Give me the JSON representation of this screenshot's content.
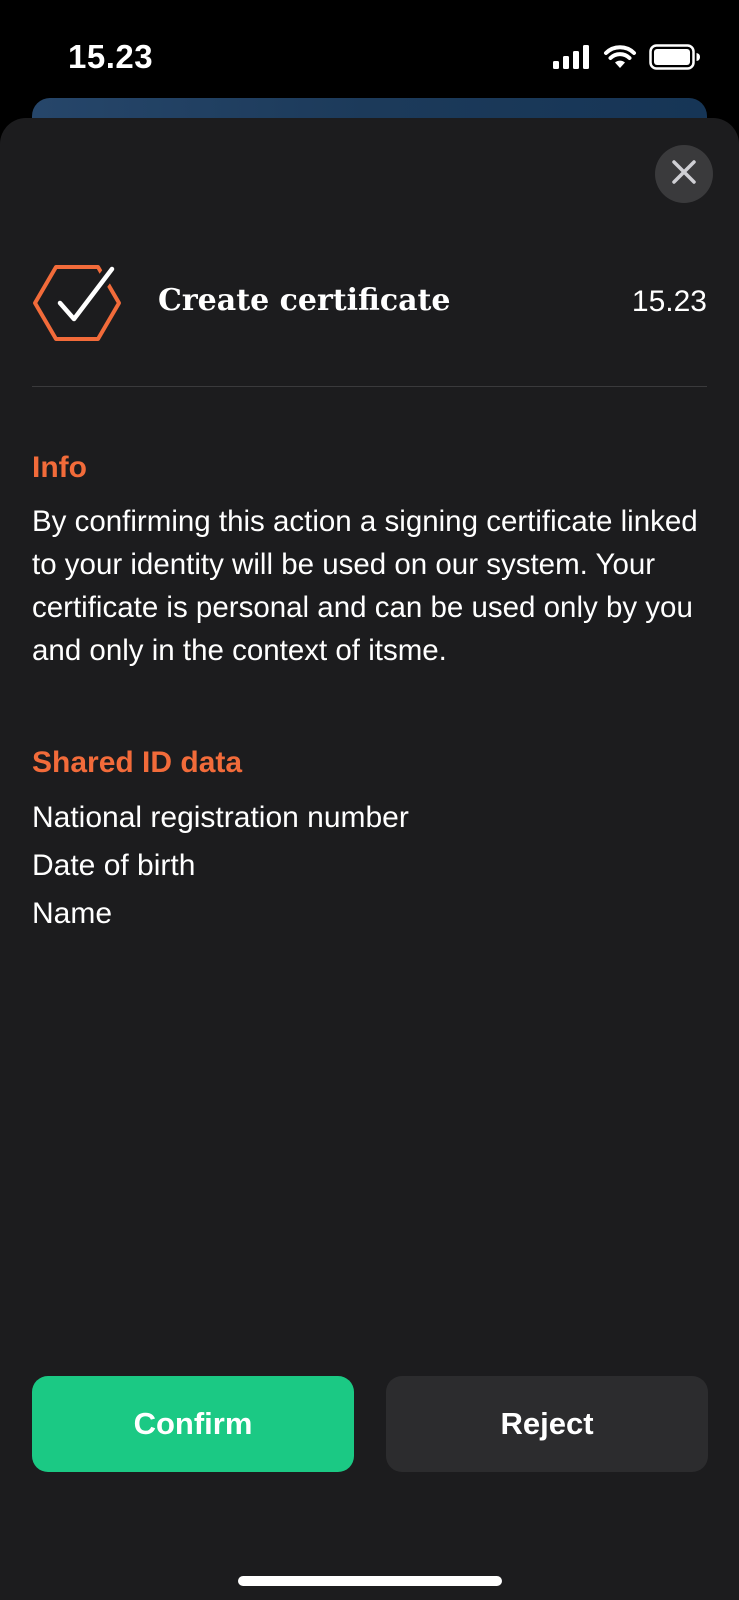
{
  "status_bar": {
    "time": "15.23",
    "icons": [
      "cellular-signal-icon",
      "wifi-icon",
      "battery-icon"
    ]
  },
  "sheet": {
    "close_icon": "close-icon",
    "header": {
      "icon": "certificate-check-icon",
      "title": "Create certificate",
      "time": "15.23"
    },
    "info": {
      "heading": "Info",
      "body": "By confirming this action a signing certificate linked to your identity will be used on our system. Your certificate is personal and can be used only by you and only in the context of itsme."
    },
    "shared": {
      "heading": "Shared ID data",
      "items": [
        "National registration number",
        "Date of birth",
        "Name"
      ]
    },
    "actions": {
      "confirm_label": "Confirm",
      "reject_label": "Reject"
    }
  },
  "colors": {
    "accent": "#f26b3a",
    "confirm": "#1bc984",
    "sheet_background": "#1c1c1e",
    "reject_background": "#2c2c2e"
  }
}
